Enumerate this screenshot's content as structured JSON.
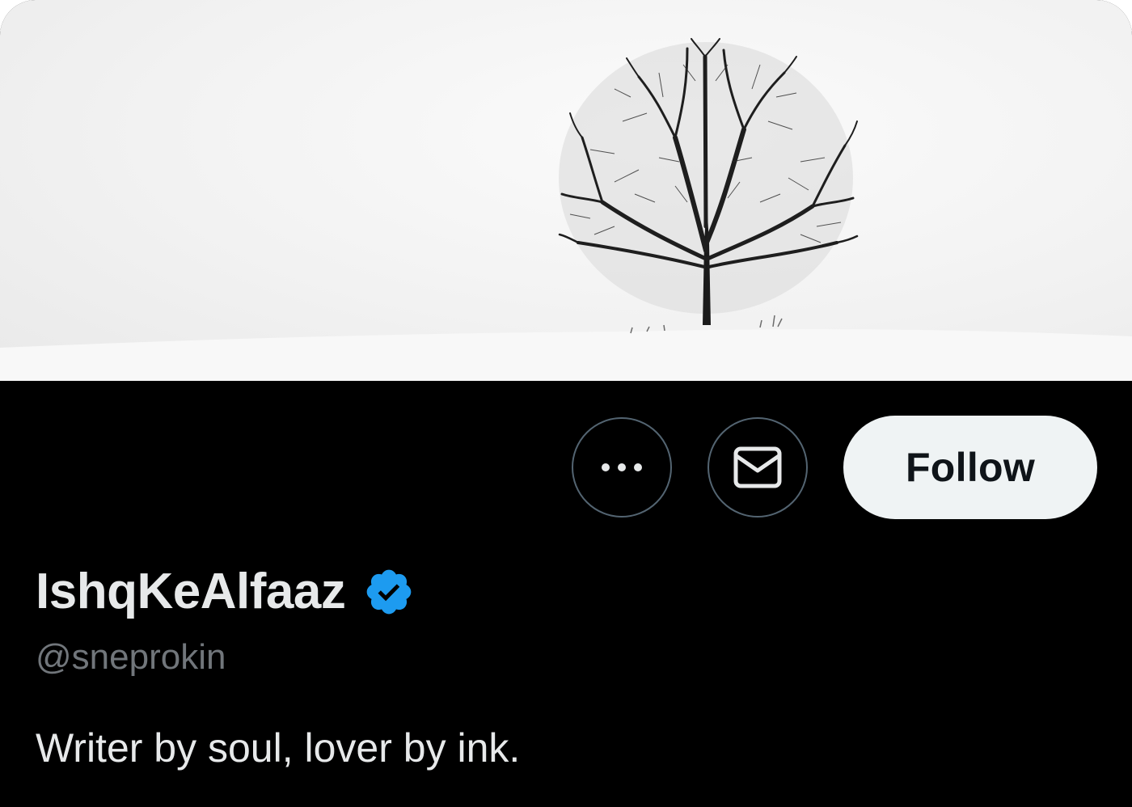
{
  "profile": {
    "banner_image": "bare-tree-snow-landscape",
    "display_name": "IshqKeAlfaaz",
    "verified_badge_icon": "verified-badge-icon",
    "handle": "@sneprokin",
    "bio": "Writer by soul, lover by ink."
  },
  "actions": {
    "more_icon": "more-horizontal-icon",
    "message_icon": "envelope-icon",
    "follow_label": "Follow"
  },
  "colors": {
    "background": "#000000",
    "verified_blue": "#1d9bf0",
    "follow_bg": "#eff3f4",
    "handle_gray": "#71767b",
    "button_border": "#536471"
  }
}
